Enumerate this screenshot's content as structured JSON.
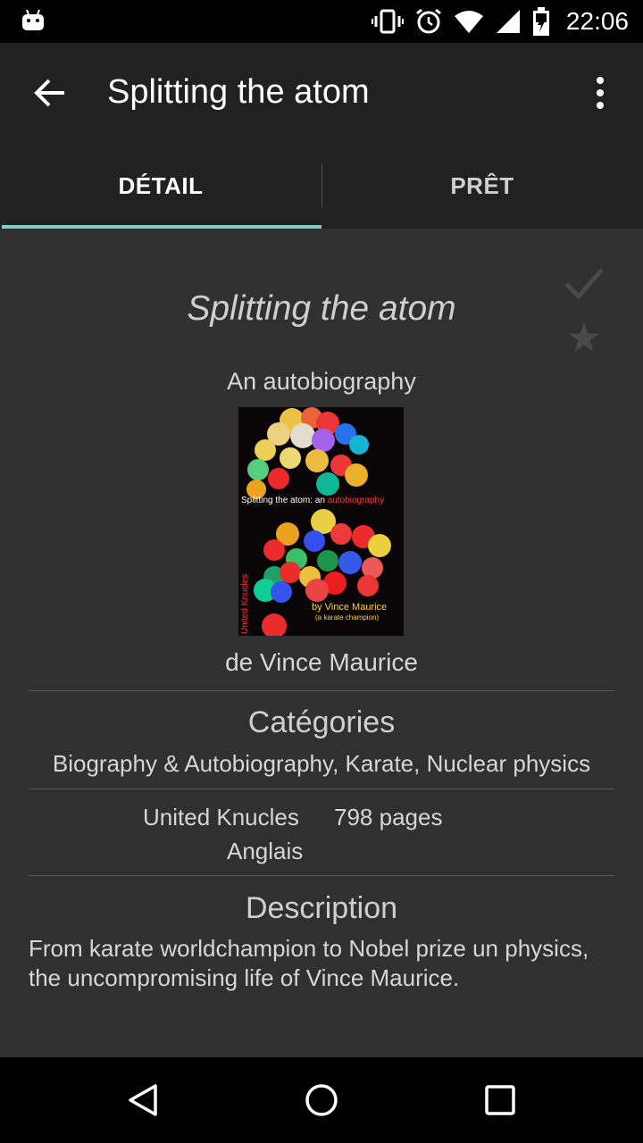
{
  "status_bar": {
    "time": "22:06",
    "icons": [
      "android-icon",
      "vibrate-icon",
      "alarm-icon",
      "wifi-icon",
      "signal-icon",
      "battery-icon"
    ]
  },
  "app_bar": {
    "title": "Splitting the atom",
    "back_icon": "arrow-back-icon",
    "menu_icon": "more-vert-icon"
  },
  "tabs": [
    {
      "label": "DÉTAIL",
      "active": true
    },
    {
      "label": "PRÊT",
      "active": false
    }
  ],
  "colors": {
    "background": "#303030",
    "toolbar": "#212121",
    "tab_indicator": "#80cbc4",
    "status_bar": "#000000"
  },
  "book": {
    "title": "Splitting the atom",
    "subtitle": "An autobiography",
    "author_line": "de Vince Maurice",
    "read_icon": "check-icon",
    "favorite_icon": "star-icon",
    "cover": {
      "title_part1": "Splitting the atom: an ",
      "title_part2": "autobiography",
      "author": "by Vince Maurice",
      "author_note": "(a karate champion)",
      "publisher": "United Knucles"
    },
    "categories_heading": "Catégories",
    "categories": "Biography & Autobiography, Karate, Nuclear physics",
    "publisher": "United Knucles",
    "pages": "798 pages",
    "language": "Anglais",
    "description_heading": "Description",
    "description": "From karate worldchampion to Nobel prize un physics, the uncompromising life of Vince Maurice."
  }
}
